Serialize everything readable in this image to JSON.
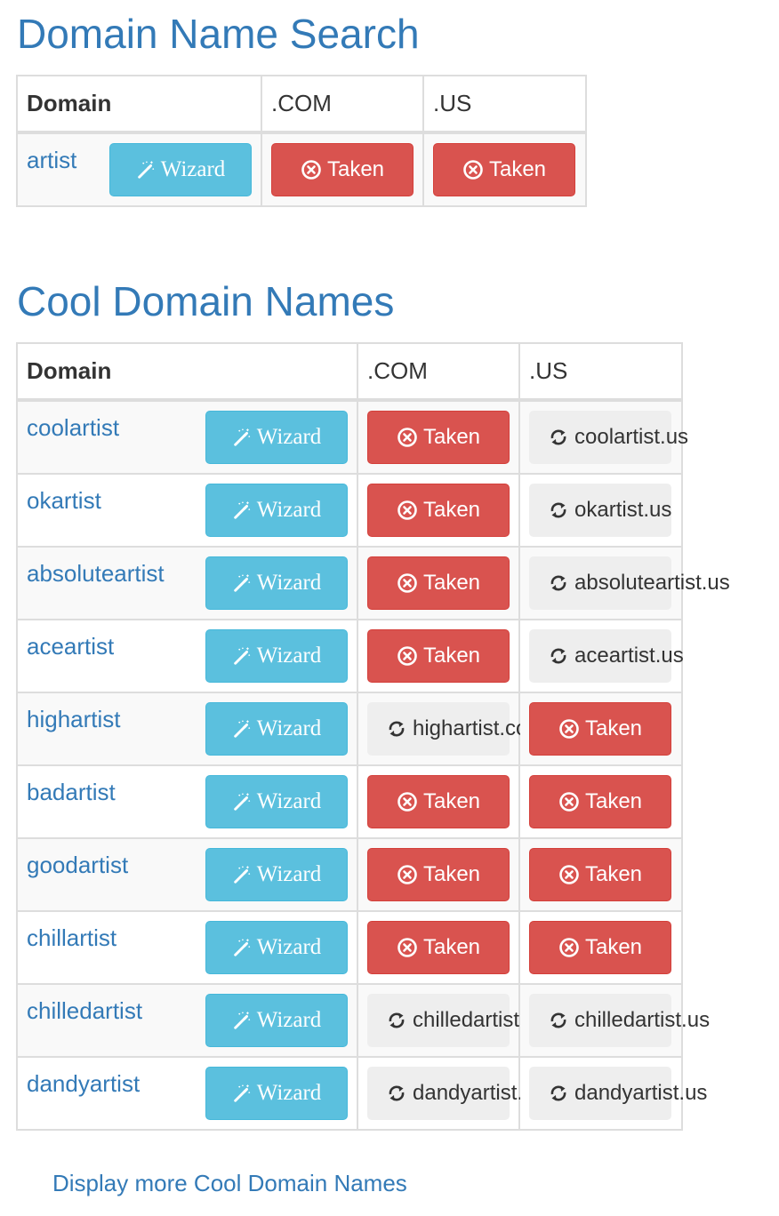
{
  "search": {
    "title": "Domain Name Search",
    "headers": {
      "domain": "Domain",
      "com": ".COM",
      "us": ".US"
    },
    "rows": [
      {
        "domain": "artist",
        "wizard_label": "Wizard",
        "com": {
          "status": "taken",
          "label": "Taken"
        },
        "us": {
          "status": "taken",
          "label": "Taken"
        }
      }
    ]
  },
  "cool": {
    "title": "Cool Domain Names",
    "headers": {
      "domain": "Domain",
      "com": ".COM",
      "us": ".US"
    },
    "rows": [
      {
        "domain": "coolartist",
        "wizard_label": "Wizard",
        "com": {
          "status": "taken",
          "label": "Taken"
        },
        "us": {
          "status": "checking",
          "label": "coolartist.us"
        }
      },
      {
        "domain": "okartist",
        "wizard_label": "Wizard",
        "com": {
          "status": "taken",
          "label": "Taken"
        },
        "us": {
          "status": "checking",
          "label": "okartist.us"
        }
      },
      {
        "domain": "absoluteartist",
        "wizard_label": "Wizard",
        "com": {
          "status": "taken",
          "label": "Taken"
        },
        "us": {
          "status": "checking",
          "label": "absoluteartist.us"
        }
      },
      {
        "domain": "aceartist",
        "wizard_label": "Wizard",
        "com": {
          "status": "taken",
          "label": "Taken"
        },
        "us": {
          "status": "checking",
          "label": "aceartist.us"
        }
      },
      {
        "domain": "highartist",
        "wizard_label": "Wizard",
        "com": {
          "status": "checking",
          "label": "highartist.com"
        },
        "us": {
          "status": "taken",
          "label": "Taken"
        }
      },
      {
        "domain": "badartist",
        "wizard_label": "Wizard",
        "com": {
          "status": "taken",
          "label": "Taken"
        },
        "us": {
          "status": "taken",
          "label": "Taken"
        }
      },
      {
        "domain": "goodartist",
        "wizard_label": "Wizard",
        "com": {
          "status": "taken",
          "label": "Taken"
        },
        "us": {
          "status": "taken",
          "label": "Taken"
        }
      },
      {
        "domain": "chillartist",
        "wizard_label": "Wizard",
        "com": {
          "status": "taken",
          "label": "Taken"
        },
        "us": {
          "status": "taken",
          "label": "Taken"
        }
      },
      {
        "domain": "chilledartist",
        "wizard_label": "Wizard",
        "com": {
          "status": "checking",
          "label": "chilledartist.com"
        },
        "us": {
          "status": "checking",
          "label": "chilledartist.us"
        }
      },
      {
        "domain": "dandyartist",
        "wizard_label": "Wizard",
        "com": {
          "status": "checking",
          "label": "dandyartist.com"
        },
        "us": {
          "status": "checking",
          "label": "dandyartist.us"
        }
      }
    ]
  },
  "more_link": "Display more Cool Domain Names",
  "icons": {
    "wizard": "magic-wand-icon",
    "taken": "x-circle-icon",
    "checking": "refresh-icon"
  },
  "colors": {
    "link": "#337ab7",
    "wizard_bg": "#5bc0de",
    "taken_bg": "#d9534f",
    "checking_bg": "#eeeeee",
    "stripe": "#f9f9f9",
    "border": "#dddddd"
  }
}
